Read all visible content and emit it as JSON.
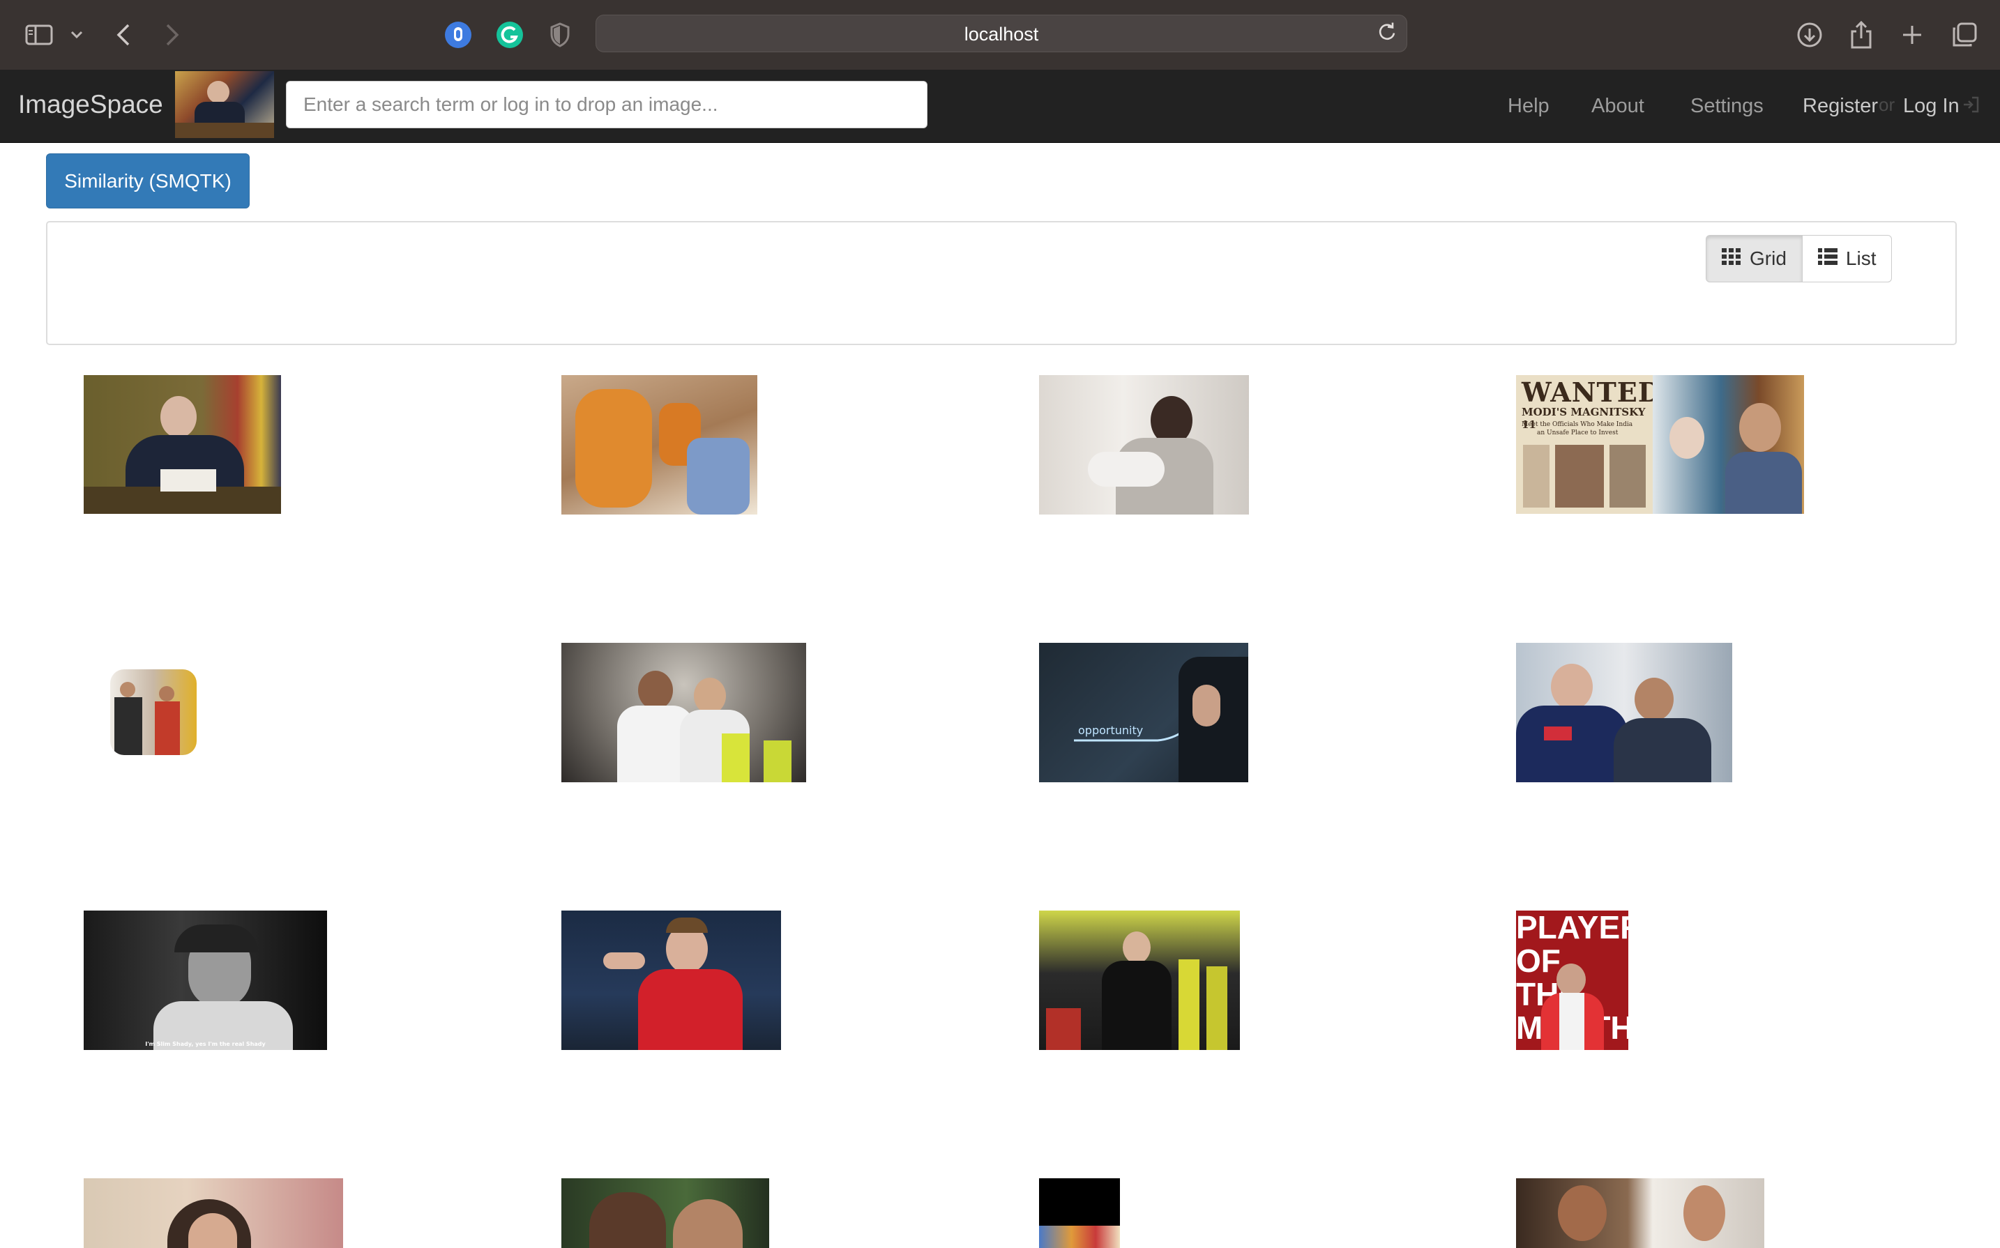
{
  "browser": {
    "url": "localhost",
    "icon_names": [
      "sidebar-icon",
      "chevron-down-icon",
      "back-icon",
      "forward-icon",
      "extension-hand-icon",
      "grammarly-icon",
      "privacy-shield-icon",
      "reload-icon",
      "download-icon",
      "share-icon",
      "new-tab-icon",
      "tabs-overview-icon"
    ]
  },
  "navbar": {
    "brand": "ImageSpace",
    "search_placeholder": "Enter a search term or log in to drop an image...",
    "links": {
      "help": "Help",
      "about": "About",
      "settings": "Settings",
      "register": "Register",
      "or": "or",
      "login": "Log In"
    },
    "colors": {
      "background": "#222222",
      "link": "#9d9d9d"
    }
  },
  "main": {
    "similarity_button": "Similarity (SMQTK)",
    "view_toggle": {
      "grid": "Grid",
      "list": "List",
      "active": "grid"
    },
    "accent_color": "#337ab7"
  },
  "thumbnails": [
    {
      "name": "thumb-man-at-desk"
    },
    {
      "name": "thumb-monks-seated"
    },
    {
      "name": "thumb-mother-with-baby"
    },
    {
      "name": "thumb-wanted-poster-collage",
      "text_line1": "WANTED",
      "text_line2": "MODI'S MAGNITSKY 11",
      "text_line3": "Meet the Officials Who Make India",
      "text_line4": "an Unsafe Place to Invest"
    },
    {
      "name": "thumb-two-men-small"
    },
    {
      "name": "thumb-football-celebration"
    },
    {
      "name": "thumb-opportunity-chart",
      "text": "opportunity"
    },
    {
      "name": "thumb-racing-team-men"
    },
    {
      "name": "thumb-bw-portrait",
      "caption": "I'm Slim Shady, yes I'm the real Shady"
    },
    {
      "name": "thumb-footballer-red-kit"
    },
    {
      "name": "thumb-coach-stadium"
    },
    {
      "name": "thumb-player-of-the-month",
      "text": "PLAYER OF THE MONTH"
    },
    {
      "name": "thumb-woman-portrait"
    },
    {
      "name": "thumb-couple-closeup"
    },
    {
      "name": "thumb-dark-small"
    },
    {
      "name": "thumb-two-men-mirror"
    }
  ]
}
